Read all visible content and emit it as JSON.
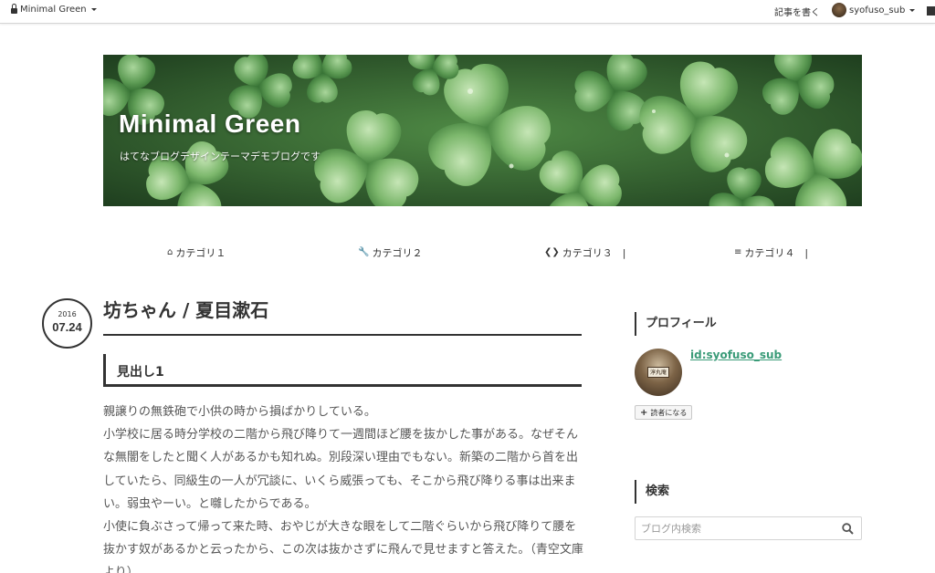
{
  "topbar": {
    "blog_switch_label": "Minimal Green",
    "write_label": "記事を書く",
    "username": "syofuso_sub"
  },
  "banner": {
    "title": "Minimal Green",
    "description": "はてなブログデザインテーマデモブログです"
  },
  "nav": {
    "items": [
      {
        "icon": "home-icon",
        "label": "カテゴリ１",
        "sep": ""
      },
      {
        "icon": "wrench-icon",
        "label": "カテゴリ２",
        "sep": ""
      },
      {
        "icon": "code-icon",
        "label": "カテゴリ３",
        "sep": "|"
      },
      {
        "icon": "list-icon",
        "label": "カテゴリ４",
        "sep": "|"
      }
    ]
  },
  "post": {
    "date_year": "2016",
    "date_day": "07.24",
    "title": "坊ちゃん / 夏目漱石",
    "heading1": "見出し1",
    "paragraphs": [
      "親譲りの無鉄砲で小供の時から損ばかりしている。",
      "小学校に居る時分学校の二階から飛び降りて一週間ほど腰を抜かした事がある。なぜそんな無闇をしたと聞く人があるかも知れぬ。別段深い理由でもない。新築の二階から首を出していたら、同級生の一人が冗談に、いくら威張っても、そこから飛び降りる事は出来まい。弱虫やーい。と囃したからである。",
      "小使に負ぶさって帰って来た時、おやじが大きな眼をして二階ぐらいから飛び降りて腰を抜かす奴があるかと云ったから、この次は抜かさずに飛んで見せますと答えた。（青空文庫より）"
    ]
  },
  "sidebar": {
    "profile_heading": "プロフィール",
    "profile_id": "id:syofuso_sub",
    "avatar_sign": "淳丸庵",
    "follow_label": "読者になる",
    "search_heading": "検索",
    "search_placeholder": "ブログ内検索"
  },
  "colors": {
    "accent": "#3a9b78",
    "text": "#333333"
  }
}
